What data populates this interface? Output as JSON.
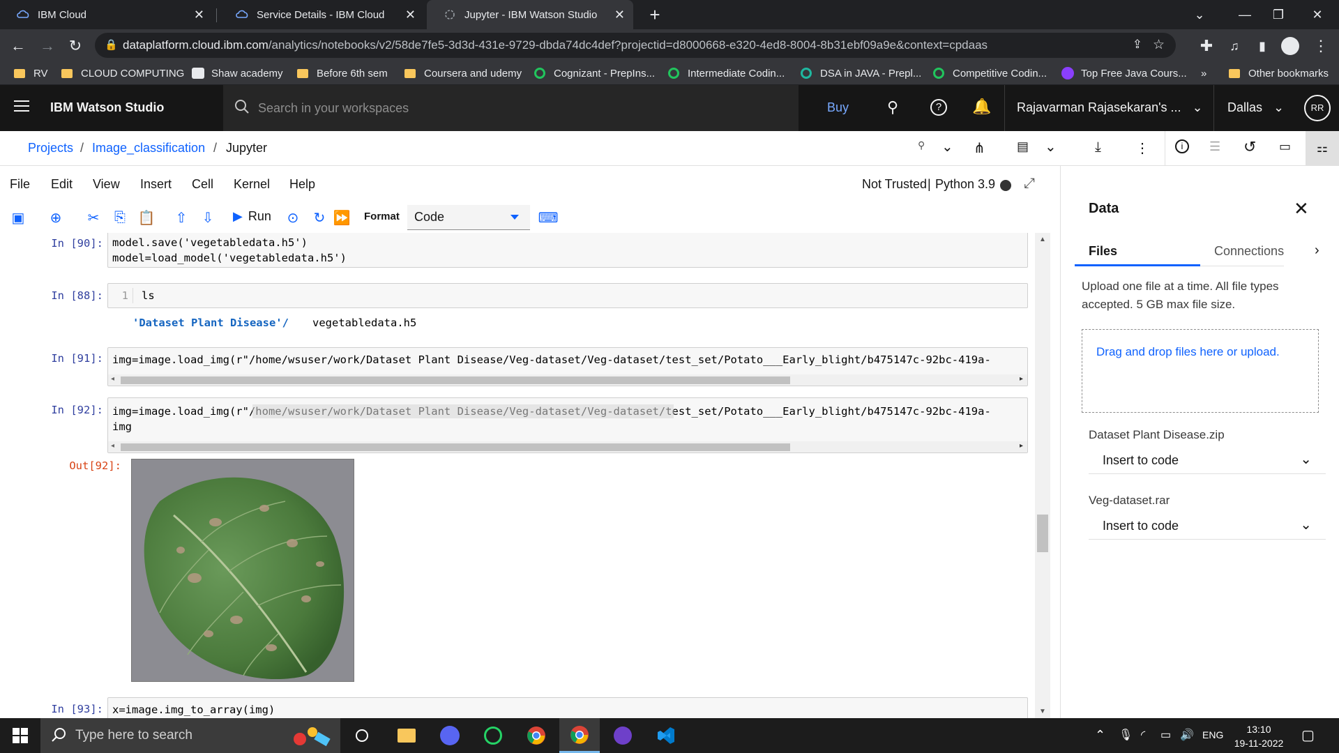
{
  "browser": {
    "tabs": [
      {
        "title": "IBM Cloud"
      },
      {
        "title": "Service Details - IBM Cloud"
      },
      {
        "title": "Jupyter - IBM Watson Studio"
      }
    ],
    "address": {
      "host": "dataplatform.cloud.ibm.com",
      "path": "/analytics/notebooks/v2/58de7fe5-3d3d-431e-9729-dbda74dc4def?projectid=d8000668-e320-4ed8-8004-8b31ebf09a9e&context=cpdaas"
    },
    "bookmarks": [
      {
        "label": "RV"
      },
      {
        "label": "CLOUD COMPUTING"
      },
      {
        "label": "Shaw academy"
      },
      {
        "label": "Before 6th sem"
      },
      {
        "label": "Coursera and udemy"
      },
      {
        "label": "Cognizant - PrepIns..."
      },
      {
        "label": "Intermediate Codin..."
      },
      {
        "label": "DSA in JAVA - Prepl..."
      },
      {
        "label": "Competitive Codin..."
      },
      {
        "label": "Top Free Java Cours..."
      },
      {
        "label": "»"
      },
      {
        "label": "Other bookmarks"
      }
    ]
  },
  "header": {
    "brand": "IBM Watson Studio",
    "search_placeholder": "Search in your workspaces",
    "buy": "Buy",
    "account": "Rajavarman Rajasekaran's ...",
    "region": "Dallas",
    "avatar": "RR"
  },
  "breadcrumb": {
    "projects": "Projects",
    "sep": "/",
    "project": "Image_classification",
    "current": "Jupyter"
  },
  "notebook": {
    "menus": [
      "File",
      "Edit",
      "View",
      "Insert",
      "Cell",
      "Kernel",
      "Help"
    ],
    "not_trusted": "Not Trusted",
    "kernel": "Python 3.9",
    "run_label": "Run",
    "format_label": "Format",
    "cell_type": "Code",
    "cells": [
      {
        "prompt": "In [90]:",
        "lines": [
          "model.save('vegetabledata.h5')",
          "model=load_model('vegetabledata.h5')"
        ]
      },
      {
        "prompt": "In [88]:",
        "line_no": "1",
        "lines": [
          "ls"
        ],
        "output": [
          "'Dataset Plant Disease'/",
          "vegetabledata.h5"
        ]
      },
      {
        "prompt": "In [91]:",
        "lines": [
          "img=image.load_img(r\"/home/wsuser/work/Dataset Plant Disease/Veg-dataset/Veg-dataset/test_set/Potato___Early_blight/b475147c-92bc-419a-"
        ]
      },
      {
        "prompt": "In [92]:",
        "lines": [
          "img=image.load_img(r\"/home/wsuser/work/Dataset Plant Disease/Veg-dataset/Veg-dataset/test_set/Potato___Early_blight/b475147c-92bc-419a-",
          "img"
        ],
        "out_prompt": "Out[92]:"
      },
      {
        "prompt": "In [93]:",
        "lines": [
          "x=image.img_to_array(img)"
        ]
      }
    ]
  },
  "data_panel": {
    "title": "Data",
    "tabs": [
      "Files",
      "Connections"
    ],
    "upload_info": "Upload one file at a time. All file types accepted. 5 GB max file size.",
    "dropzone": "Drag and drop files here or upload.",
    "files": [
      {
        "name": "Dataset Plant Disease.zip",
        "action": "Insert to code"
      },
      {
        "name": "Veg-dataset.rar",
        "action": "Insert to code"
      }
    ]
  },
  "taskbar": {
    "search_placeholder": "Type here to search",
    "lang": "ENG",
    "time": "13:10",
    "date": "19-11-2022"
  },
  "colors": {
    "accent": "#0f62fe",
    "header_bg": "#161616",
    "chrome_bg": "#202124"
  }
}
